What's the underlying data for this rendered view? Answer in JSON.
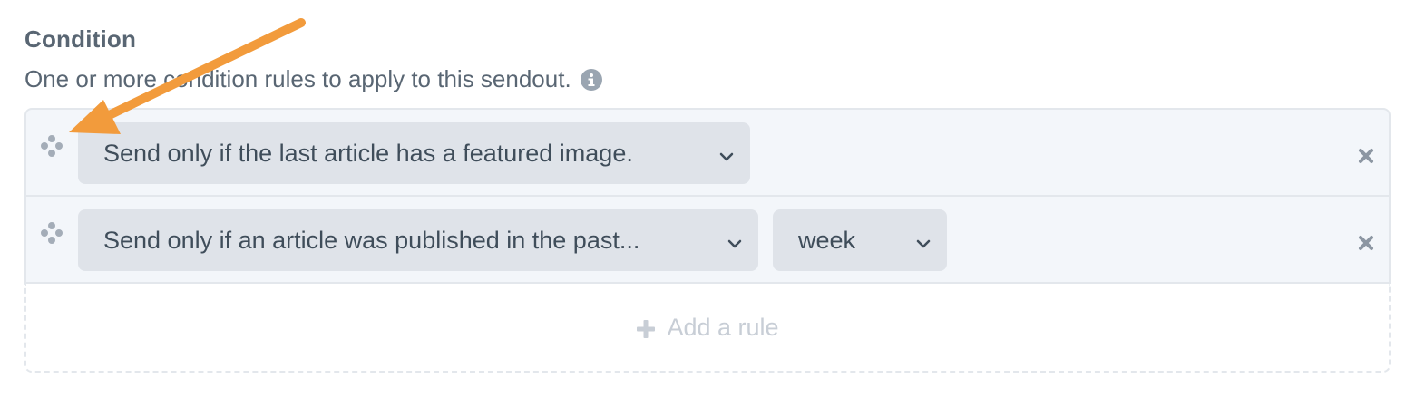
{
  "field": {
    "heading": "Condition",
    "instructions": "One or more condition rules to apply to this sendout.",
    "info_icon": "info-circle-icon"
  },
  "rules": [
    {
      "condition": "Send only if the last article has a featured image.",
      "drag_icon": "drag-handle-icon",
      "remove_icon": "close-icon"
    },
    {
      "condition": "Send only if an article was published in the past...",
      "period": "week",
      "drag_icon": "drag-handle-icon",
      "remove_icon": "close-icon"
    }
  ],
  "add_rule": {
    "label": "Add a rule",
    "icon": "plus-icon"
  },
  "colors": {
    "annotation_arrow": "#f29b3c",
    "select_bg": "#dfe3e9",
    "rule_bg": "#f3f6fa"
  }
}
